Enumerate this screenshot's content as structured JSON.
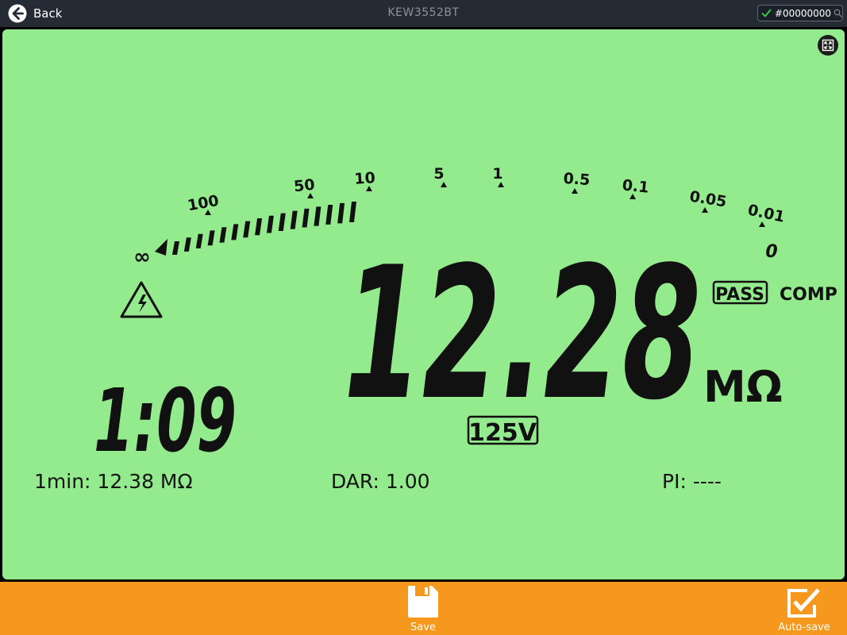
{
  "nav": {
    "back_label": "Back",
    "device_title": "KEW3552BT",
    "device_id": "#00000000"
  },
  "lcd": {
    "scale_labels": [
      "100",
      "50",
      "10",
      "5",
      "1",
      "0.5",
      "0.1",
      "0.05",
      "0.01",
      "0"
    ],
    "infinity_symbol": "∞",
    "main_value": "12.28",
    "unit": "MΩ",
    "pass_label": "PASS",
    "comp_label": "COMP",
    "voltage_label": "125V",
    "timer": "1:09",
    "bar_segments_lit": 16,
    "warning_icon": "high-voltage-warning-icon"
  },
  "readings": {
    "one_min": "1min: 12.38 MΩ",
    "dar": "DAR:  1.00",
    "pi": "PI: ----"
  },
  "bottom": {
    "save_label": "Save",
    "autosave_label": "Auto-save"
  },
  "colors": {
    "lcd_background": "#93eb8d",
    "topbar": "#242b35",
    "bottombar": "#f6981e"
  }
}
